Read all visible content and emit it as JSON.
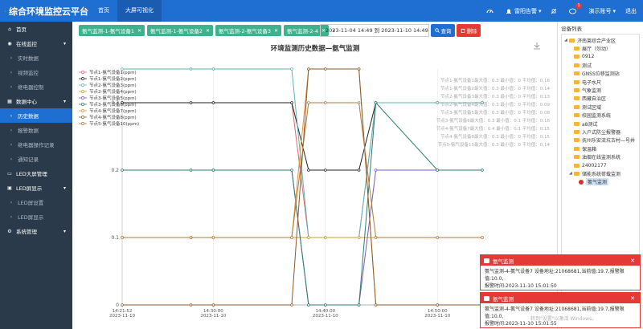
{
  "app": {
    "title": "综合环境监控云平台"
  },
  "topnav": [
    "首页",
    "大屏可视化"
  ],
  "topright": {
    "alarm_label": "雷阳告警",
    "alarm_badge": "1",
    "account_label": "演示账号",
    "logout_label": "退出"
  },
  "sidebar": [
    {
      "label": "首页",
      "type": "group",
      "icon": "home-icon"
    },
    {
      "label": "在线监控",
      "type": "group",
      "icon": "monitor-icon",
      "caret": "▾"
    },
    {
      "label": "实时数据",
      "type": "sub"
    },
    {
      "label": "视频监控",
      "type": "sub"
    },
    {
      "label": "继电器控制",
      "type": "sub"
    },
    {
      "label": "数据中心",
      "type": "group",
      "icon": "data-icon",
      "caret": "▾"
    },
    {
      "label": "历史数据",
      "type": "sub",
      "active": true
    },
    {
      "label": "报警数据",
      "type": "sub"
    },
    {
      "label": "继电器操作记录",
      "type": "sub"
    },
    {
      "label": "通知记录",
      "type": "sub"
    },
    {
      "label": "LED大屏管理",
      "type": "group",
      "icon": "led-icon"
    },
    {
      "label": "LED屏显示",
      "type": "group",
      "icon": "screen-icon",
      "caret": "▾"
    },
    {
      "label": "LED屏设置",
      "type": "sub"
    },
    {
      "label": "LED屏显示",
      "type": "sub"
    },
    {
      "label": "系统管理",
      "type": "group",
      "icon": "gear-icon",
      "caret": "▾"
    }
  ],
  "filters": {
    "tags": [
      "氨气监测-1-氨气设备1",
      "氨气监测-1-氨气设备2",
      "氨气监测-2-氨气设备3",
      "氨气监测-2-4"
    ],
    "date_range": "2023-11-04 14:49 到 2023-11-10 14:49",
    "query_label": "查询",
    "delete_label": "删除"
  },
  "chart_data": {
    "type": "line",
    "title": "环境监测历史数据—氨气监测",
    "ylim": [
      0,
      0.35
    ],
    "yticks": [
      "0",
      "0.1",
      "0.2",
      "0.3"
    ],
    "xticks": [
      {
        "time": "14:21:52",
        "date": "2023-11-10"
      },
      {
        "time": "14:30:00",
        "date": "2023-11-10"
      },
      {
        "time": "14:40:00",
        "date": "2023-11-10"
      },
      {
        "time": "14:50:00",
        "date": "2023-11-10"
      }
    ],
    "x": [
      "14:21:52",
      "14:28:00",
      "14:30:00",
      "14:37:00",
      "14:38:30",
      "14:40:00",
      "14:43:00",
      "14:44:30",
      "14:50:00",
      "14:54:00"
    ],
    "series": [
      {
        "name": "节点1-氨气设备1(ppm)",
        "color": "#e06666",
        "values": [
          0.3,
          0.3,
          0.3,
          0.3,
          0.1,
          0.1,
          0.1,
          0.3,
          0.3,
          0.3
        ]
      },
      {
        "name": "节点1-氨气设备2(ppm)",
        "color": "#222222",
        "values": [
          0.3,
          0.3,
          0.3,
          0.3,
          0.2,
          0.2,
          0.2,
          0.3,
          0.3,
          0.3
        ]
      },
      {
        "name": "节点2-氨气设备3(ppm)",
        "color": "#5fb3b3",
        "values": [
          0.35,
          0.35,
          0.35,
          0.35,
          0.1,
          0.1,
          0.1,
          0.3,
          0.3,
          0.3
        ]
      },
      {
        "name": "节点2-氨气设备4(ppm)",
        "color": "#c9a227",
        "values": [
          0.1,
          0.1,
          0.1,
          0.1,
          0.1,
          0.1,
          0.1,
          0.1,
          0.1,
          0.1
        ]
      },
      {
        "name": "节点3-氨气设备5(ppm)",
        "color": "#7e57c2",
        "values": [
          0.2,
          0.2,
          0.2,
          0.2,
          0.0,
          0.0,
          0.0,
          0.2,
          0.2,
          0.2
        ]
      },
      {
        "name": "节点3-氨气设备6(ppm)",
        "color": "#2e7d6b",
        "values": [
          0.2,
          0.2,
          0.2,
          0.2,
          0.0,
          0.0,
          0.0,
          0.3,
          0.2,
          0.2
        ]
      },
      {
        "name": "节点4-氨气设备7(ppm)",
        "color": "#e69138",
        "values": [
          0.1,
          0.1,
          0.1,
          0.1,
          0.35,
          0.35,
          0.35,
          0.0,
          0.0,
          0.0
        ]
      },
      {
        "name": "节点4-氨气设备8(ppm)",
        "color": "#8b5a2b",
        "values": [
          0.0,
          0.0,
          0.0,
          0.0,
          0.35,
          0.35,
          0.35,
          0.0,
          0.0,
          0.0
        ]
      },
      {
        "name": "节点5-氨气设备10(ppm)",
        "color": "#b07a3b",
        "values": [
          0.1,
          0.1,
          0.1,
          0.1,
          0.3,
          0.3,
          0.3,
          0.1,
          0.1,
          0.1
        ]
      }
    ],
    "stats": [
      "节点1-氨气设备1最大值：0.3 最小值：0 平均值：0.16",
      "节点1-氨气设备2最大值：0.3 最小值：0 平均值：0.14",
      "节点2-氨气设备3最大值：0.3 最小值：0 平均值：0.13",
      "节点2-氨气设备4最大值：0.3 最小值：0 平均值：0.09",
      "节点3-氨气设备5最大值：0.3 最小值：0 平均值：0.08",
      "节点3-氨气设备6最大值：0.3 最小值：0.1 平均值：0.16",
      "节点4-氨气设备7最大值：0.4 最小值：0.1 平均值：0.15",
      "节点4-氨气设备8最大值：0.3 最小值：0 平均值：0.15",
      "节点5-氨气设备10最大值：0.3 最小值：0 平均值：0.14"
    ]
  },
  "tree": {
    "title": "设备列表",
    "nodes": [
      {
        "label": "济南莱综合产业区",
        "level": 0,
        "toggle": "◢"
      },
      {
        "label": "展厅（勿动）",
        "level": 1
      },
      {
        "label": "0912",
        "level": 1
      },
      {
        "label": "测试",
        "level": 1
      },
      {
        "label": "GNSS位移监测站",
        "level": 1
      },
      {
        "label": "电子水尺",
        "level": 1
      },
      {
        "label": "气象监测",
        "level": 1
      },
      {
        "label": "西藏自治区",
        "level": 1
      },
      {
        "label": "测试区域",
        "level": 1
      },
      {
        "label": "校园监测系统",
        "level": 1
      },
      {
        "label": "a8测试",
        "level": 1
      },
      {
        "label": "入户式防尘报警器",
        "level": 1
      },
      {
        "label": "抚州乐安流坑古村—号井",
        "level": 1
      },
      {
        "label": "保温箱",
        "level": 1
      },
      {
        "label": "油烟在线监测系统",
        "level": 1
      },
      {
        "label": "24002177",
        "level": 1
      },
      {
        "label": "储能系统荷载监测",
        "level": 1,
        "toggle": "◢"
      },
      {
        "label": "氨气监测",
        "level": 2,
        "leaf": true,
        "selected": true
      }
    ]
  },
  "alerts": [
    {
      "title": "氨气监测",
      "line1": "氨气监测-4-氨气设备7 设备地址:21068681,当前值:19.7,报警限值:10.0,",
      "line2": "报警时间:2023-11-10 15:01:50"
    },
    {
      "title": "氨气监测",
      "line1": "氨气监测-4-氨气设备7 设备地址:21068681,当前值:19.7,报警限值:10.0,",
      "line2": "报警时间:2023-11-10 15:01:55"
    }
  ],
  "watermark": "转到\"设置\"以激活 Windows。"
}
